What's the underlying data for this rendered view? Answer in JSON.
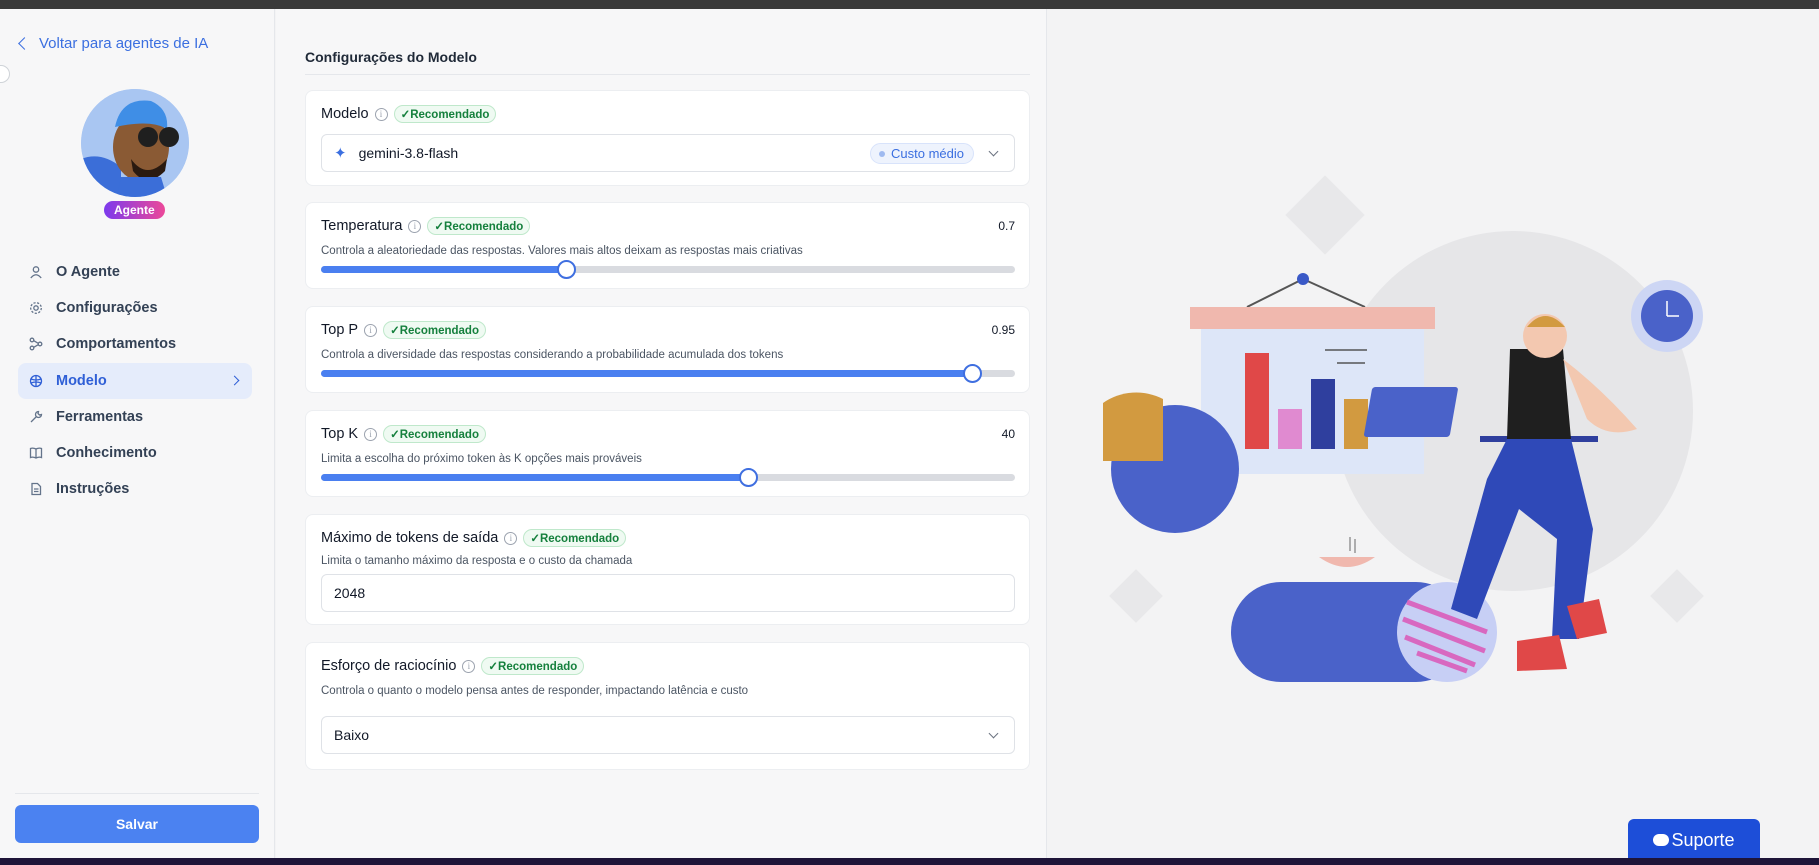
{
  "sidebar": {
    "back_label": "Voltar para agentes de IA",
    "badge": "Agente",
    "items": [
      {
        "label": "O Agente",
        "icon": "user-icon"
      },
      {
        "label": "Configurações",
        "icon": "gear-icon"
      },
      {
        "label": "Comportamentos",
        "icon": "flow-icon"
      },
      {
        "label": "Modelo",
        "icon": "brain-icon",
        "active": true
      },
      {
        "label": "Ferramentas",
        "icon": "wrench-icon"
      },
      {
        "label": "Conhecimento",
        "icon": "book-icon"
      },
      {
        "label": "Instruções",
        "icon": "document-icon"
      }
    ],
    "save_label": "Salvar"
  },
  "main": {
    "section_title": "Configurações do Modelo",
    "recommended": "✓Recomendado",
    "model": {
      "label": "Modelo",
      "value": "gemini-3.8-flash",
      "cost": "Custo médio"
    },
    "temperature": {
      "label": "Temperatura",
      "value": "0.7",
      "fraction": 0.353,
      "description": "Controla a aleatoriedade das respostas. Valores mais altos deixam as respostas mais criativas"
    },
    "top_p": {
      "label": "Top P",
      "value": "0.95",
      "fraction": 0.938,
      "description": "Controla a diversidade das respostas considerando a probabilidade acumulada dos tokens"
    },
    "top_k": {
      "label": "Top K",
      "value": "40",
      "fraction": 0.615,
      "description": "Limita a escolha do próximo token às K opções mais prováveis"
    },
    "max_tokens": {
      "label": "Máximo de tokens de saída",
      "value": "2048",
      "description": "Limita o tamanho máximo da resposta e o custo da chamada"
    },
    "reasoning": {
      "label": "Esforço de raciocínio",
      "value": "Baixo",
      "description": "Controla o quanto o modelo pensa antes de responder, impactando latência e custo"
    }
  },
  "support": {
    "label": "Suporte"
  },
  "colors": {
    "accent": "#4b82f1",
    "recommended": "#15803d",
    "support": "#1d4ed8"
  }
}
